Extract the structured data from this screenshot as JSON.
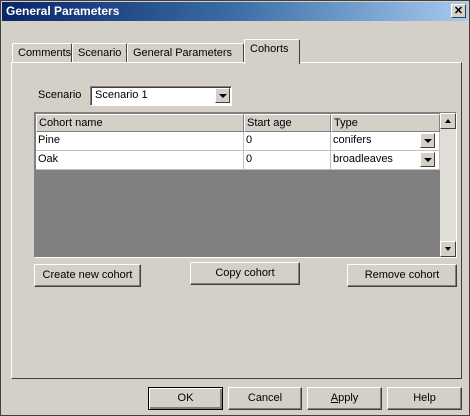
{
  "window": {
    "title": "General Parameters",
    "close_glyph": "✕"
  },
  "tabs": [
    {
      "label": "Comments",
      "active": false
    },
    {
      "label": "Scenario",
      "active": false
    },
    {
      "label": "General Parameters",
      "active": false
    },
    {
      "label": "Cohorts",
      "active": true
    }
  ],
  "scenario": {
    "label": "Scenario",
    "value": "Scenario 1"
  },
  "table": {
    "columns": [
      "Cohort name",
      "Start age",
      "Type"
    ],
    "rows": [
      {
        "name": "Pine",
        "start_age": "0",
        "type": "conifers"
      },
      {
        "name": "Oak",
        "start_age": "0",
        "type": "broadleaves"
      }
    ]
  },
  "actions": {
    "create": "Create new cohort",
    "copy": "Copy cohort",
    "remove": "Remove cohort"
  },
  "footer": {
    "ok": "OK",
    "cancel": "Cancel",
    "apply_prefix": "A",
    "apply_rest": "pply",
    "help": "Help"
  },
  "colors": {
    "title_gradient_start": "#0a246a",
    "dialog_face": "#d4d0c8",
    "empty_grid": "#808080"
  },
  "icons": {
    "close": "close-icon",
    "dropdown": "chevron-down-icon",
    "scroll_up": "scroll-up-arrow-icon",
    "scroll_down": "scroll-down-arrow-icon"
  }
}
